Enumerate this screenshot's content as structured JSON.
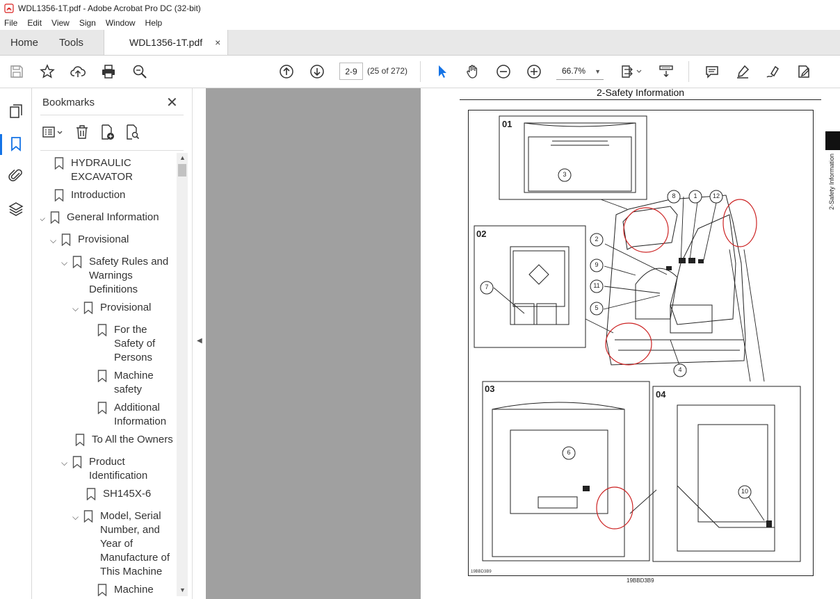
{
  "window": {
    "title": "WDL1356-1T.pdf - Adobe Acrobat Pro DC (32-bit)"
  },
  "menu": [
    "File",
    "Edit",
    "View",
    "Sign",
    "Window",
    "Help"
  ],
  "tabs": {
    "home": "Home",
    "tools": "Tools",
    "document": "WDL1356-1T.pdf",
    "close": "×"
  },
  "toolbar": {
    "page_input": "2-9",
    "page_count": "(25 of 272)",
    "zoom": "66.7%"
  },
  "bookmarks": {
    "title": "Bookmarks",
    "close": "✕",
    "items": [
      {
        "label": "HYDRAULIC\nEXCAVATOR",
        "depth": 0,
        "expand": ""
      },
      {
        "label": "Introduction",
        "depth": 0,
        "expand": ""
      },
      {
        "label": "General Information",
        "depth": 0,
        "expand": "expanded"
      },
      {
        "label": "Provisional",
        "depth": 1,
        "expand": "expanded"
      },
      {
        "label": "Safety Rules and\nWarnings\nDefinitions",
        "depth": 2,
        "expand": "expanded"
      },
      {
        "label": "Provisional",
        "depth": 3,
        "expand": "expanded"
      },
      {
        "label": "For the\nSafety of\nPersons",
        "depth": 4,
        "expand": ""
      },
      {
        "label": "Machine\nsafety",
        "depth": 4,
        "expand": ""
      },
      {
        "label": "Additional\nInformation",
        "depth": 4,
        "expand": ""
      },
      {
        "label": "To All the Owners",
        "depth": 2,
        "expand": ""
      },
      {
        "label": "Product\nIdentification",
        "depth": 2,
        "expand": "expanded"
      },
      {
        "label": "SH145X-6",
        "depth": 3,
        "expand": ""
      },
      {
        "label": "Model, Serial\nNumber, and\nYear of\nManufacture of\nThis Machine",
        "depth": 3,
        "expand": "expanded"
      },
      {
        "label": "Machine",
        "depth": 4,
        "expand": ""
      }
    ]
  },
  "document": {
    "header": "2-Safety Information",
    "side_tab": "2-Safety Information",
    "figure": {
      "panels": [
        "01",
        "02",
        "03",
        "04"
      ],
      "callouts": [
        "1",
        "2",
        "3",
        "4",
        "5",
        "6",
        "7",
        "8",
        "9",
        "10",
        "11",
        "12"
      ],
      "code_inner": "19BBD3B9",
      "code": "19BBD3B9"
    }
  },
  "colors": {
    "accent": "#1473e6",
    "doc_bg": "#a0a0a0",
    "pdf_red": "#d9201f",
    "highlight_circle": "#cc2222"
  }
}
